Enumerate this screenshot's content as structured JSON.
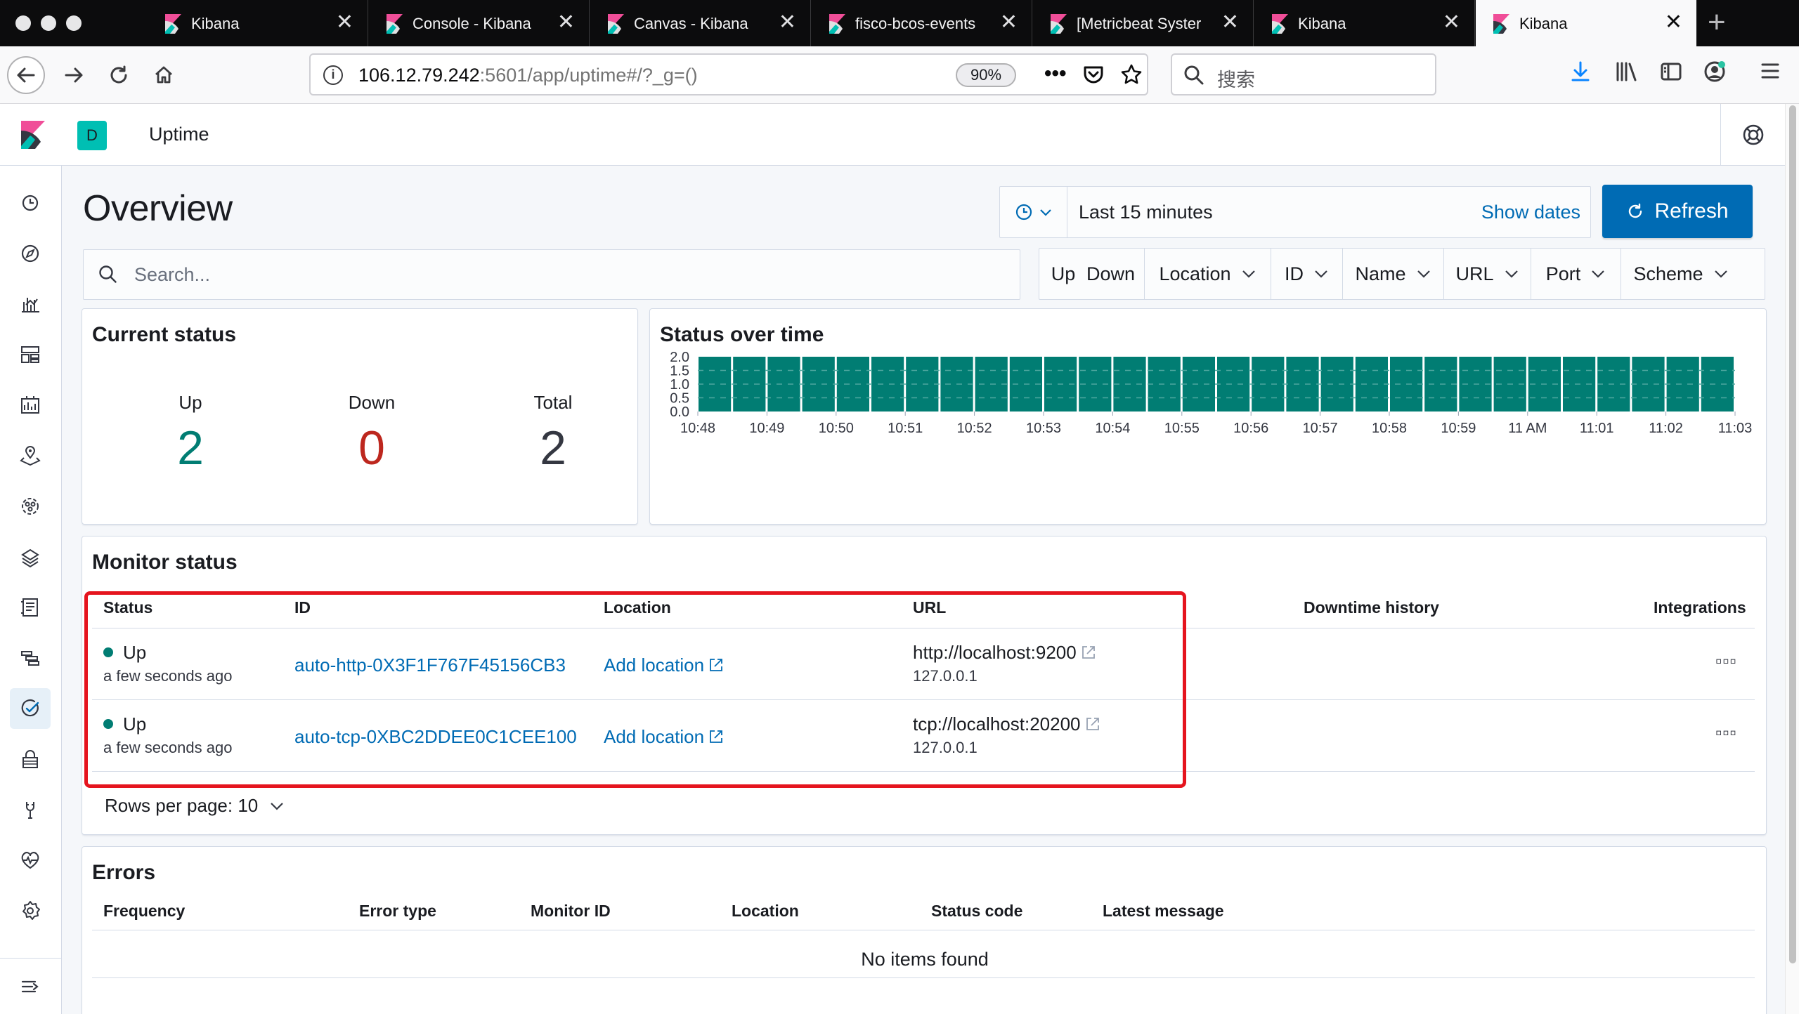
{
  "browser": {
    "tabs": [
      {
        "title": "Kibana",
        "active": false
      },
      {
        "title": "Console - Kibana",
        "active": false
      },
      {
        "title": "Canvas - Kibana",
        "active": false
      },
      {
        "title": "fisco-bcos-events",
        "active": false
      },
      {
        "title": "[Metricbeat Syster",
        "active": false
      },
      {
        "title": "Kibana",
        "active": false
      },
      {
        "title": "Kibana",
        "active": true
      }
    ],
    "url_host": "106.12.79.242",
    "url_rest": ":5601/app/uptime#/?_g=()",
    "zoom": "90%",
    "search_placeholder": "搜索"
  },
  "header": {
    "space_initial": "D",
    "app_title": "Uptime"
  },
  "sidenav": {
    "items": [
      "recent-icon",
      "discover-icon",
      "visualize-icon",
      "dashboard-icon",
      "canvas-icon",
      "maps-icon",
      "ml-icon",
      "infrastructure-icon",
      "logs-icon",
      "apm-icon",
      "uptime-icon",
      "dev-tools-icon",
      "monitoring-icon",
      "stack-management-icon",
      "management-icon",
      "collapse-icon"
    ]
  },
  "page": {
    "title": "Overview",
    "time_range": "Last 15 minutes",
    "show_dates": "Show dates",
    "refresh": "Refresh",
    "search_placeholder": "Search...",
    "filters": [
      "Up",
      "Down",
      "Location",
      "ID",
      "Name",
      "URL",
      "Port",
      "Scheme"
    ]
  },
  "current_status": {
    "title": "Current status",
    "up_label": "Up",
    "up_value": "2",
    "down_label": "Down",
    "down_value": "0",
    "total_label": "Total",
    "total_value": "2",
    "up_color": "#017d73",
    "down_color": "#bd271e"
  },
  "status_over_time": {
    "title": "Status over time"
  },
  "chart_data": {
    "type": "bar",
    "title": "Status over time",
    "categories": [
      "10:48",
      "10:49",
      "10:50",
      "10:51",
      "10:52",
      "10:53",
      "10:54",
      "10:55",
      "10:56",
      "10:57",
      "10:58",
      "10:59",
      "11 AM",
      "11:01",
      "11:02",
      "11:03"
    ],
    "bars_per_category": 2,
    "values": [
      2,
      2,
      2,
      2,
      2,
      2,
      2,
      2,
      2,
      2,
      2,
      2,
      2,
      2,
      2,
      2,
      2,
      2,
      2,
      2,
      2,
      2,
      2,
      2,
      2,
      2,
      2,
      2,
      2,
      2
    ],
    "y_ticks": [
      "2.0",
      "1.5",
      "1.0",
      "0.5",
      "0.0"
    ],
    "ylim": [
      0,
      2
    ],
    "color": "#017d73",
    "grid": true
  },
  "monitor_status": {
    "title": "Monitor status",
    "columns": [
      "Status",
      "ID",
      "Location",
      "URL",
      "Downtime history",
      "Integrations"
    ],
    "rows": [
      {
        "status": "Up",
        "ago": "a few seconds ago",
        "id": "auto-http-0X3F1F767F45156CB3",
        "location": "Add location",
        "url": "http://localhost:9200",
        "ip": "127.0.0.1"
      },
      {
        "status": "Up",
        "ago": "a few seconds ago",
        "id": "auto-tcp-0XBC2DDEE0C1CEE100",
        "location": "Add location",
        "url": "tcp://localhost:20200",
        "ip": "127.0.0.1"
      }
    ],
    "rows_per_page": "Rows per page: 10"
  },
  "errors": {
    "title": "Errors",
    "columns": [
      "Frequency",
      "Error type",
      "Monitor ID",
      "Location",
      "Status code",
      "Latest message"
    ],
    "empty": "No items found"
  }
}
